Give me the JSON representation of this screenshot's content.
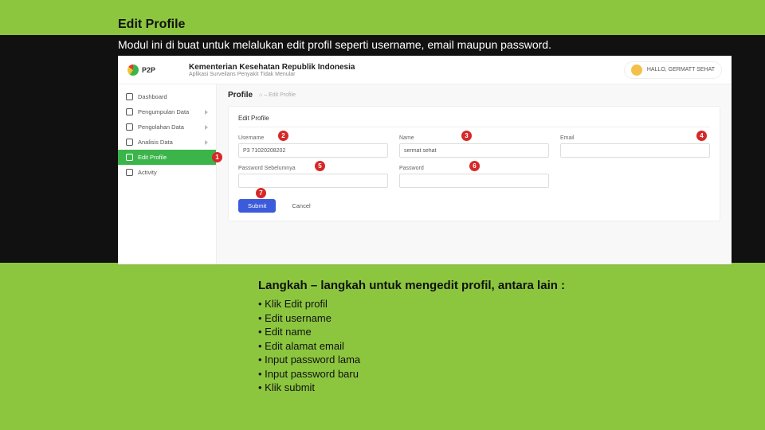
{
  "title": "Edit Profile",
  "subtitle": "Modul ini di buat untuk melalukan edit profil seperti username, email maupun password.",
  "screenshot": {
    "logo_text": "P2P",
    "app_title": "Kementerian Kesehatan Republik Indonesia",
    "app_tagline": "Aplikasi Surveilans Penyakit Tidak Menular",
    "user_greeting": "HALLO, GERMATT SEHAT",
    "sidebar": [
      {
        "label": "Dashboard",
        "expandable": false
      },
      {
        "label": "Pengumpulan Data",
        "expandable": true
      },
      {
        "label": "Pengolahan Data",
        "expandable": true
      },
      {
        "label": "Analisis Data",
        "expandable": true
      },
      {
        "label": "Edit Profile",
        "expandable": false,
        "active": true
      },
      {
        "label": "Activity",
        "expandable": false
      }
    ],
    "crumb_title": "Profile",
    "crumb_path": "⌂  –  Edit Profile",
    "card_title": "Edit Profile",
    "fields": {
      "username": {
        "label": "Username",
        "value": "P3 71020208202"
      },
      "name": {
        "label": "Name",
        "value": "sermat sehat"
      },
      "email": {
        "label": "Email",
        "value": ""
      },
      "old_pw": {
        "label": "Password Sebelumnya",
        "value": ""
      },
      "new_pw": {
        "label": "Password",
        "value": ""
      }
    },
    "buttons": {
      "submit": "Submit",
      "cancel": "Cancel"
    },
    "markers": {
      "1": "1",
      "2": "2",
      "3": "3",
      "4": "4",
      "5": "5",
      "6": "6",
      "7": "7"
    }
  },
  "steps": {
    "heading": "Langkah – langkah  untuk mengedit profil, antara lain :",
    "items": [
      "Klik Edit profil",
      "Edit username",
      "Edit name",
      "Edit alamat email",
      "Input password lama",
      "Input password baru",
      "Klik submit"
    ]
  }
}
